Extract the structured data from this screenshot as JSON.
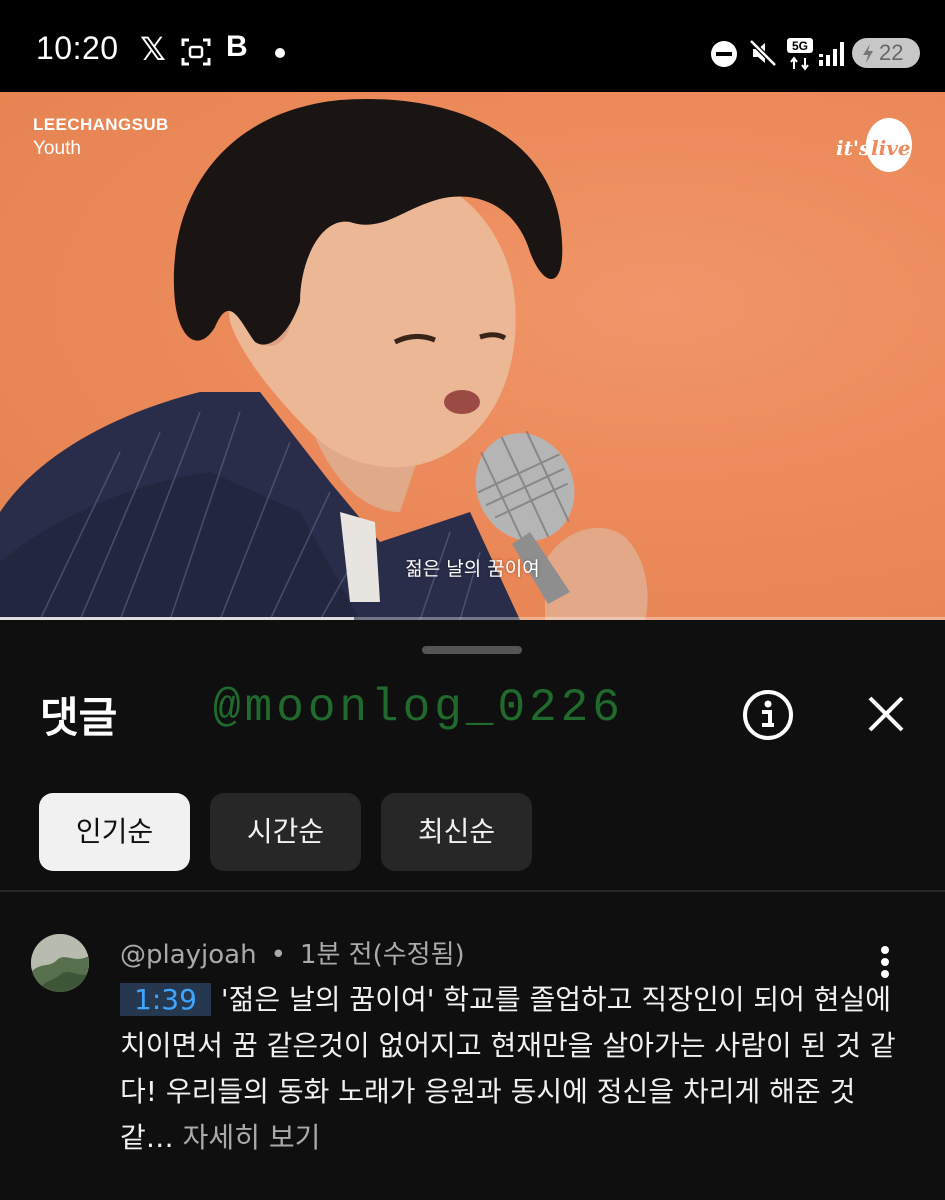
{
  "status_bar": {
    "time": "10:20",
    "x_app": "𝕏",
    "b_app": "B",
    "network": "5G",
    "battery": "22"
  },
  "video": {
    "artist": "LEECHANGSUB",
    "song": "Youth",
    "logo_left": "it's",
    "logo_right": "live",
    "subtitle": "젊은 날의 꿈이여",
    "progress_fraction": 0.375
  },
  "comments_panel": {
    "title": "댓글",
    "watermark": "@moonlog_0226",
    "sort_chips": [
      {
        "label": "인기순",
        "active": true
      },
      {
        "label": "시간순",
        "active": false
      },
      {
        "label": "최신순",
        "active": false
      }
    ],
    "comment": {
      "author": "@playjoah",
      "separator": "•",
      "time": "1분 전(수정됨)",
      "timestamp": "1:39",
      "text": "'젊은 날의 꿈이여' 학교를 졸업하고 직장인이 되어 현실에 치이면서 꿈 같은것이 없어지고 현재만을 살아가는 사람이 된 것 같다! 우리들의 동화 노래가 응원과 동시에 정신을 차리게 해준 것 같…",
      "read_more": "자세히 보기"
    }
  },
  "colors": {
    "video_background": "#ec8a5b",
    "panel_background": "#0f0f0f",
    "chip_active": "#f1f1f1",
    "chip_inactive": "#272727",
    "timestamp_link": "#3ea6ff",
    "watermark": "#1f6a2c"
  }
}
